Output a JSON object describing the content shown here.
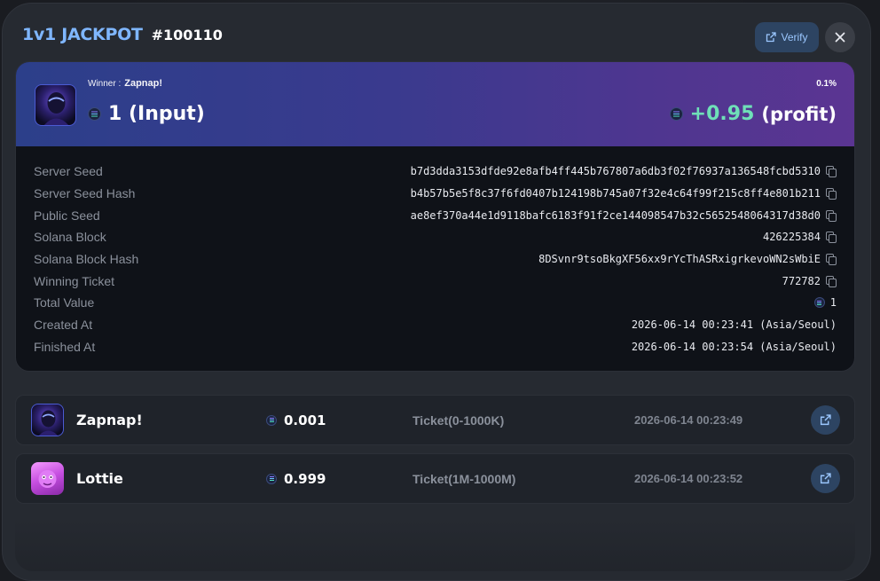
{
  "header": {
    "title": "1v1 JACKPOT",
    "round_id": "#100110",
    "verify_label": "Verify"
  },
  "winner": {
    "label": "Winner :",
    "name": "Zapnap!",
    "input_amount": "1 (Input)",
    "chance_pct": "0.1%",
    "profit_value": "+0.95",
    "profit_label": "(profit)"
  },
  "details": [
    {
      "key": "Server Seed",
      "value": "b7d3dda3153dfde92e8afb4ff445b767807a6db3f02f76937a136548fcbd5310",
      "copy": true,
      "coin": false
    },
    {
      "key": "Server Seed Hash",
      "value": "b4b57b5e5f8c37f6fd0407b124198b745a07f32e4c64f99f215c8ff4e801b211",
      "copy": true,
      "coin": false
    },
    {
      "key": "Public Seed",
      "value": "ae8ef370a44e1d9118bafc6183f91f2ce144098547b32c5652548064317d38d0",
      "copy": true,
      "coin": false
    },
    {
      "key": "Solana Block",
      "value": "426225384",
      "copy": true,
      "coin": false
    },
    {
      "key": "Solana Block Hash",
      "value": "8DSvnr9tsoBkgXF56xx9rYcThASRxigrkevoWN2sWbiE",
      "copy": true,
      "coin": false
    },
    {
      "key": "Winning Ticket",
      "value": "772782",
      "copy": true,
      "coin": false
    },
    {
      "key": "Total Value",
      "value": "1",
      "copy": false,
      "coin": true
    },
    {
      "key": "Created At",
      "value": "2026-06-14 00:23:41 (Asia/Seoul)",
      "copy": false,
      "coin": false
    },
    {
      "key": "Finished At",
      "value": "2026-06-14 00:23:54 (Asia/Seoul)",
      "copy": false,
      "coin": false
    }
  ],
  "players": [
    {
      "name": "Zapnap!",
      "amount": "0.001",
      "ticket": "Ticket(0-1000K)",
      "time": "2026-06-14 00:23:49"
    },
    {
      "name": "Lottie",
      "amount": "0.999",
      "ticket": "Ticket(1M-1000M)",
      "time": "2026-06-14 00:23:52"
    }
  ],
  "colors": {
    "title": "#7fb6ff",
    "profit": "#6fe0b8",
    "accent_button": "#2d4462"
  },
  "icons": {
    "verify": "external-link-icon",
    "close": "close-icon",
    "copy": "copy-icon",
    "coin": "solana-coin-icon",
    "player_link": "external-link-icon"
  }
}
